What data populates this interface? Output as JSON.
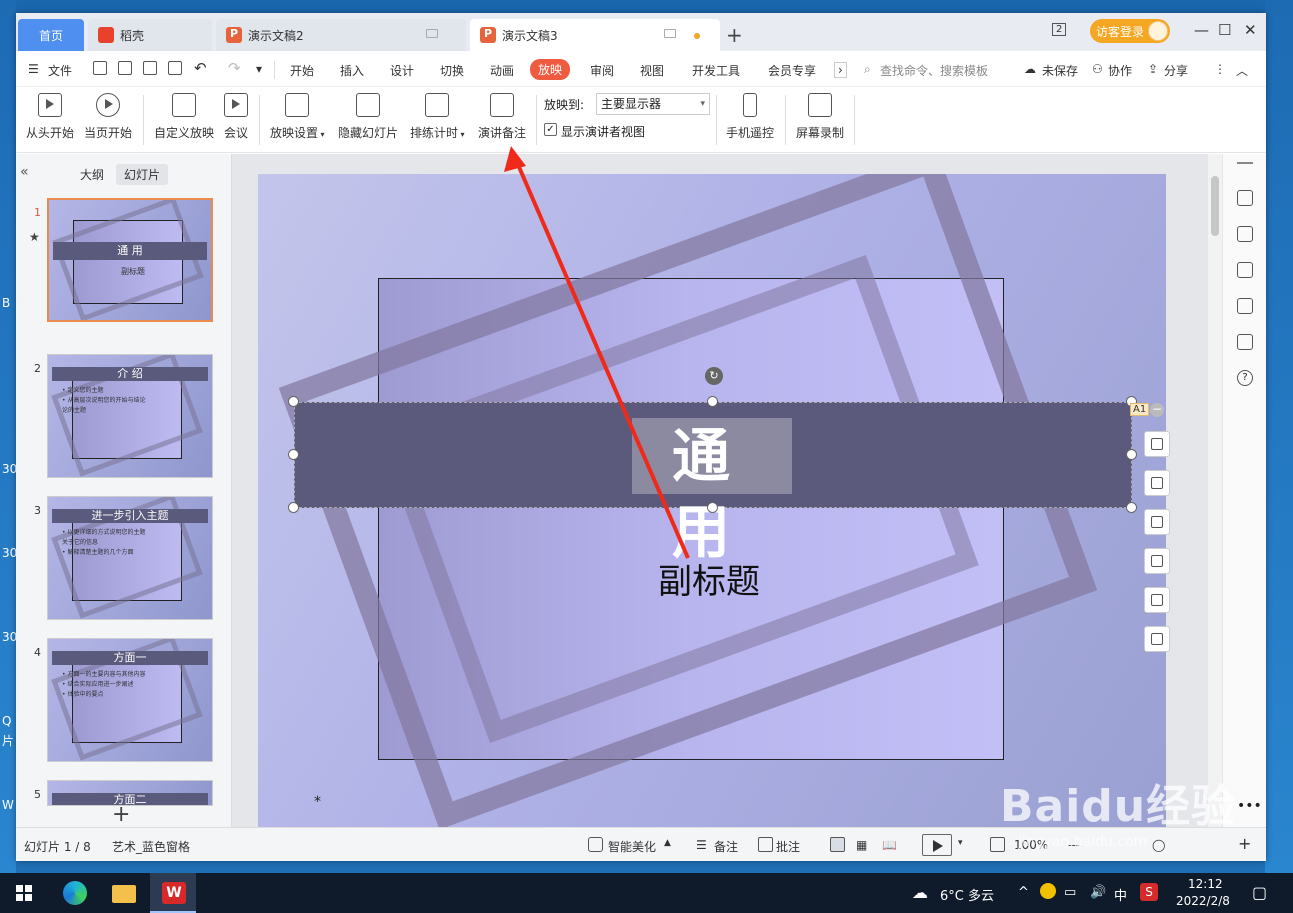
{
  "desktop": {
    "left_glyphs": [
      "B",
      "30",
      "30",
      "30",
      "Q",
      "片",
      "W"
    ]
  },
  "tabs": {
    "home": "首页",
    "daoke": "稻壳",
    "doc2": "演示文稿2",
    "doc3": "演示文稿3"
  },
  "titlebar": {
    "count": "2",
    "login": "访客登录"
  },
  "menu": {
    "file": "文件",
    "items": [
      "开始",
      "插入",
      "设计",
      "切换",
      "动画",
      "放映",
      "审阅",
      "视图",
      "开发工具",
      "会员专享"
    ],
    "active": "放映",
    "search": "查找命令、搜索模板",
    "unsaved": "未保存",
    "collab": "协作",
    "share": "分享"
  },
  "ribbon": {
    "from_start": "从头开始",
    "from_current": "当页开始",
    "custom": "自定义放映",
    "meeting": "会议",
    "settings": "放映设置",
    "hide_slide": "隐藏幻灯片",
    "rehearse": "排练计时",
    "notes": "演讲备注",
    "show_to_label": "放映到:",
    "show_to_value": "主要显示器",
    "presenter_view": "显示演讲者视图",
    "phone_remote": "手机遥控",
    "screen_record": "屏幕录制"
  },
  "left_panel": {
    "tab_outline": "大纲",
    "tab_slides": "幻灯片",
    "slides": [
      {
        "num": "1",
        "title": "通 用",
        "lines": [
          "副标题"
        ]
      },
      {
        "num": "2",
        "title": "介 绍",
        "lines": [
          "• 定义您的主题",
          "• 从高层次说明您的开始与结论",
          "  论的主题"
        ]
      },
      {
        "num": "3",
        "title": "进一步引入主题",
        "lines": [
          "• 以更详细的方式说明您的主题",
          "  关于它的信息",
          "• 解释清楚主题的几个方面"
        ]
      },
      {
        "num": "4",
        "title": "方面一",
        "lines": [
          "• 方面一的主要内容与其他内容",
          "• 结合实际应用进一步阐述",
          "• 体验中的要点"
        ]
      },
      {
        "num": "5",
        "title": "方面二",
        "lines": []
      }
    ]
  },
  "slide": {
    "title": "通 用",
    "subtitle": "副标题",
    "tag": "A1"
  },
  "status": {
    "slide_counter": "幻灯片 1 / 8",
    "theme": "艺术_蓝色窗格",
    "beautify": "智能美化",
    "notes": "备注",
    "comments": "批注",
    "zoom": "100%"
  },
  "taskbar": {
    "weather": "6°C  多云",
    "ime": "中",
    "time": "12:12",
    "date": "2022/2/8"
  },
  "watermark": {
    "brand": "Baidu经验",
    "url": "jingyan.baidu.com"
  },
  "colors": {
    "accent_tab": "#4f8ff0",
    "active_menu": "#f05a3e",
    "title_bar": "#5b5a7d",
    "login": "#f5a623"
  }
}
